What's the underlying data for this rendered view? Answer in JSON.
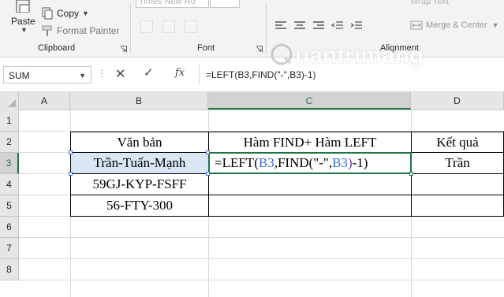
{
  "ribbon": {
    "clipboard": {
      "paste_label": "Paste",
      "copy_label": "Copy",
      "format_painter_label": "Format Painter",
      "group_label": "Clipboard"
    },
    "font": {
      "font_name": "Times New Ro",
      "group_label": "Font"
    },
    "alignment": {
      "wrap_text_label": "Wrap Text",
      "merge_center_label": "Merge & Center",
      "group_label": "Alignment"
    }
  },
  "formula_bar": {
    "name_box": "SUM",
    "fx_label": "fx",
    "formula": "=LEFT(B3,FIND(\"-\",B3)-1)"
  },
  "watermark": {
    "text": "uantrimang"
  },
  "grid": {
    "columns": [
      "A",
      "B",
      "C",
      "D"
    ],
    "active_column": "C",
    "rows": [
      "1",
      "2",
      "3",
      "4",
      "5",
      "6",
      "7",
      "8"
    ],
    "active_row": "3"
  },
  "table": {
    "headers": [
      "Văn bản",
      "Hàm FIND+ Hàm LEFT",
      "Kết quả"
    ],
    "rows": [
      {
        "text": "Trần-Tuấn-Mạnh",
        "result": "Trần"
      },
      {
        "text": "59GJ-KYP-FSFF",
        "result": ""
      },
      {
        "text": "56-FTY-300",
        "result": ""
      }
    ],
    "editing_formula": {
      "p1": "=LEFT(",
      "ref1": "B3",
      "p2": ",FIND(",
      "p3": "\"-\",",
      "ref2": "B3",
      "p4": ")",
      "p5": "-1)"
    }
  },
  "colors": {
    "excel_green": "#217346",
    "selection_fill": "#d9e6f4",
    "ref_blue": "#3a6fd8",
    "ref_purple": "#7c3aa0"
  }
}
